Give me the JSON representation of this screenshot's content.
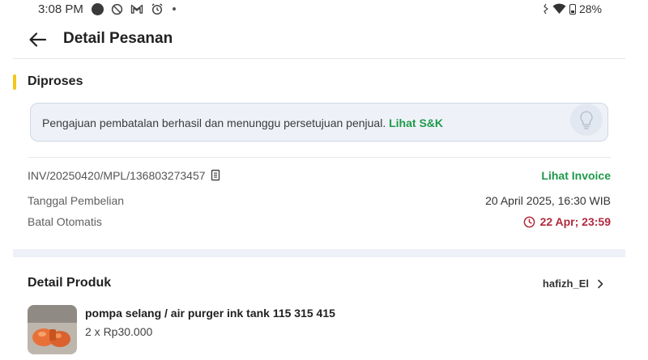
{
  "status_bar": {
    "time": "3:08 PM",
    "icons": [
      "record-dot-icon",
      "block-icon",
      "gmail-icon",
      "alarm-icon",
      "dot-icon"
    ],
    "battery": "28%",
    "right_icons": [
      "vibrate-icon",
      "wifi-icon",
      "battery-icon"
    ]
  },
  "header": {
    "title": "Detail Pesanan",
    "back_icon": "arrow-left-icon"
  },
  "order": {
    "status": "Diproses",
    "status_color": "#f5c518",
    "notice_text": "Pengajuan pembatalan berhasil dan menunggu persetujuan penjual. ",
    "notice_link": "Lihat S&K",
    "notice_icon": "lightbulb-icon",
    "invoice_number": "INV/20250420/MPL/136803273457",
    "invoice_link": "Lihat Invoice",
    "purchase_date_label": "Tanggal Pembelian",
    "purchase_date": "20 April 2025, 16:30 WIB",
    "auto_cancel_label": "Batal Otomatis",
    "auto_cancel_time": "22 Apr; 23:59",
    "auto_cancel_color": "#b02a3e",
    "link_color": "#1f9a4a"
  },
  "product_section": {
    "title": "Detail Produk",
    "seller": "hafizh_El",
    "items": [
      {
        "name": "pompa selang / air purger ink tank 115 315 415",
        "quantity_price": "2 x Rp30.000"
      }
    ]
  }
}
